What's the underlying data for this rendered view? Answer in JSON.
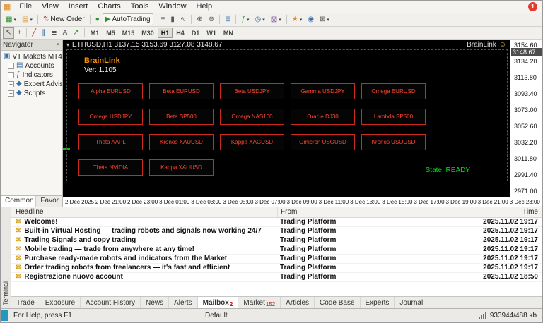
{
  "menu": {
    "items": [
      "File",
      "View",
      "Insert",
      "Charts",
      "Tools",
      "Window",
      "Help"
    ],
    "notification_badge": "1"
  },
  "icons": {
    "app": "▦",
    "caret_down": "▾",
    "new_chart": "▦",
    "chart_profiles": "▤",
    "new_order": "⇅",
    "mql_community": "●",
    "autotrading_play": "▶",
    "bars_chart": "≡",
    "candlestick_chart": "▮",
    "line_chart": "∿",
    "zoom_in": "⊕",
    "zoom_out": "⊖",
    "tile_windows": "⊞",
    "indicators": "ƒ",
    "periods": "◷",
    "templates": "▨",
    "favorites": "★",
    "notifications": "◉",
    "pointer": "↖",
    "crosshair": "+",
    "trendline": "╱",
    "channel": "∥",
    "fibonacci": "≣",
    "text_tool": "A",
    "arrows_tool": "↗",
    "close": "×",
    "tree_plus": "+",
    "server": "▣",
    "envelope": "✉",
    "smiley": "☺",
    "triangle_down": "▾"
  },
  "toolbar": {
    "new_order_label": "New Order",
    "autotrading_label": "AutoTrading",
    "tf_before": [
      "M1",
      "M5",
      "M15",
      "M30"
    ],
    "tf_active": "H1",
    "tf_after": [
      "H4",
      "D1",
      "W1",
      "MN"
    ]
  },
  "navigator": {
    "title": "Navigator",
    "root": "VT Makets MT4",
    "items": [
      {
        "label": "Accounts",
        "glyph": "▤"
      },
      {
        "label": "Indicators",
        "glyph": "ƒ"
      },
      {
        "label": "Expert Advis",
        "glyph": "◆"
      },
      {
        "label": "Scripts",
        "glyph": "◆"
      }
    ],
    "tab_common": "Common",
    "tab_favorites": "Favor"
  },
  "chart": {
    "title": "ETHUSD,H1 3137.15 3153.69 3127.08 3148.67",
    "ea_badge": "BrainLink",
    "panel": {
      "brand": "BrainLink",
      "version": "Ver: 1.105",
      "state": "State: READY",
      "buttons": [
        "Alpha EURUSD",
        "Beta EURUSD",
        "Beta USDJPY",
        "Gamma USDJPY",
        "Omega EURUSD",
        "Omega USDJPY",
        "Beta SP500",
        "Omega NAS100",
        "Oracle DJ30",
        "Lambda SP500",
        "Theta AAPL",
        "Kronos XAUUSD",
        "Kappa XAGUSD",
        "Omicron USOUSD",
        "Kronos USOUSD",
        "Theta NVIDIA",
        "Kappa XAUUSD"
      ]
    },
    "current_price": "3148.67",
    "price_axis": [
      "3154.60",
      "3134.20",
      "3113.80",
      "3093.40",
      "3073.00",
      "3052.60",
      "3032.20",
      "3011.80",
      "2991.40",
      "2971.00"
    ],
    "time_axis": [
      "2 Dec 2025",
      "2 Dec 21:00",
      "2 Dec 23:00",
      "3 Dec 01:00",
      "3 Dec 03:00",
      "3 Dec 05:00",
      "3 Dec 07:00",
      "3 Dec 09:00",
      "3 Dec 11:00",
      "3 Dec 13:00",
      "3 Dec 15:00",
      "3 Dec 17:00",
      "3 Dec 19:00",
      "3 Dec 21:00",
      "3 Dec 23:00"
    ]
  },
  "terminal": {
    "vertical_label": "Terminal",
    "columns": {
      "headline": "Headline",
      "from": "From",
      "time": "Time"
    },
    "rows": [
      {
        "headline": "Welcome!",
        "from": "Trading Platform",
        "time": "2025.11.02 19:17"
      },
      {
        "headline": "Built-in Virtual Hosting — trading robots and signals now working 24/7",
        "from": "Trading Platform",
        "time": "2025.11.02 19:17"
      },
      {
        "headline": "Trading Signals and copy trading",
        "from": "Trading Platform",
        "time": "2025.11.02 19:17"
      },
      {
        "headline": "Mobile trading — trade from anywhere at any time!",
        "from": "Trading Platform",
        "time": "2025.11.02 19:17"
      },
      {
        "headline": "Purchase ready-made robots and indicators from the Market",
        "from": "Trading Platform",
        "time": "2025.11.02 19:17"
      },
      {
        "headline": "Order trading robots from freelancers — it's fast and efficient",
        "from": "Trading Platform",
        "time": "2025.11.02 19:17"
      },
      {
        "headline": "Registrazione nuovo account",
        "from": "Trading Platform",
        "time": "2025.11.02 18:50"
      }
    ],
    "tabs_before": [
      "Trade",
      "Exposure",
      "Account History",
      "News",
      "Alerts"
    ],
    "mailbox_tab": {
      "label": "Mailbox",
      "badge": "2"
    },
    "market_tab": {
      "label": "Market",
      "badge": "152"
    },
    "tabs_after": [
      "Articles",
      "Code Base",
      "Experts",
      "Journal"
    ]
  },
  "statusbar": {
    "help": "For Help, press F1",
    "profile": "Default",
    "connection": "933944/488 kb"
  },
  "colors": {
    "ea_button_red": "#ff4530",
    "brand_orange": "#ff9500",
    "state_green": "#00dd22",
    "badge_red": "#e23b2e",
    "chart_background": "#000000"
  }
}
